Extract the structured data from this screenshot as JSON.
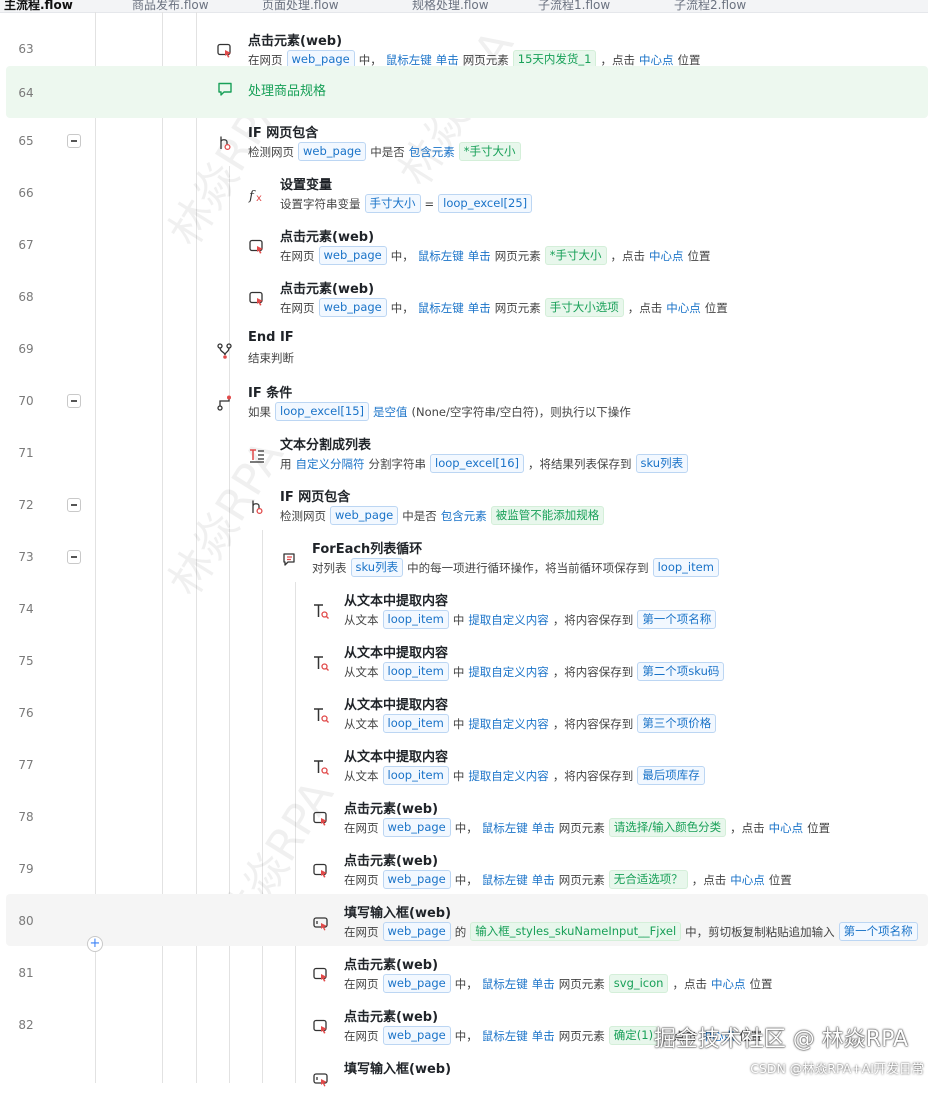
{
  "tabs": [
    "主流程.flow",
    "商品发布.flow",
    "页面处理.flow",
    "规格处理.flow",
    "子流程1.flow",
    "子流程2.flow"
  ],
  "watermark": "林焱RPA",
  "add_button": "+",
  "footer": {
    "brand": "掘金技术社区 @ 林焱RPA",
    "credit": "CSDN @林焱RPA+AI开发日常"
  },
  "icons": {
    "click": "mouse-click-icon",
    "comment": "comment-icon",
    "if_page": "branch-if-icon",
    "variable": "fx-variable-icon",
    "end_if": "end-branch-icon",
    "if_cond": "condition-icon",
    "split": "text-split-icon",
    "foreach": "loop-icon",
    "extract": "text-extract-icon",
    "fill": "input-fill-icon"
  },
  "rows": [
    {
      "no": "63",
      "title": "点击元素(web)",
      "icon": "click",
      "desc": [
        [
          "t",
          "在网页"
        ],
        [
          "c",
          "web_page"
        ],
        [
          "t",
          "中，"
        ],
        [
          "k",
          "鼠标左键"
        ],
        [
          "k",
          "单击"
        ],
        [
          "t",
          "网页元素"
        ],
        [
          "g",
          "15天内发货_1"
        ],
        [
          "t",
          "，点击"
        ],
        [
          "k",
          "中心点"
        ],
        [
          "t",
          "位置"
        ]
      ]
    },
    {
      "no": "64",
      "title": "处理商品规格",
      "icon": "comment",
      "comment": true
    },
    {
      "no": "65",
      "title": "IF 网页包含",
      "icon": "if_page",
      "fold": true,
      "desc": [
        [
          "t",
          "检测网页"
        ],
        [
          "c",
          "web_page"
        ],
        [
          "t",
          "中是否"
        ],
        [
          "k",
          "包含元素"
        ],
        [
          "g",
          "*手寸大小"
        ]
      ]
    },
    {
      "no": "66",
      "title": "设置变量",
      "icon": "variable",
      "desc": [
        [
          "t",
          "设置字符串变量"
        ],
        [
          "c",
          "手寸大小"
        ],
        [
          "t",
          "="
        ],
        [
          "c",
          "loop_excel[25]"
        ]
      ]
    },
    {
      "no": "67",
      "title": "点击元素(web)",
      "icon": "click",
      "desc": [
        [
          "t",
          "在网页"
        ],
        [
          "c",
          "web_page"
        ],
        [
          "t",
          "中，"
        ],
        [
          "k",
          "鼠标左键"
        ],
        [
          "k",
          "单击"
        ],
        [
          "t",
          "网页元素"
        ],
        [
          "g",
          "*手寸大小"
        ],
        [
          "t",
          "，点击"
        ],
        [
          "k",
          "中心点"
        ],
        [
          "t",
          "位置"
        ]
      ]
    },
    {
      "no": "68",
      "title": "点击元素(web)",
      "icon": "click",
      "desc": [
        [
          "t",
          "在网页"
        ],
        [
          "c",
          "web_page"
        ],
        [
          "t",
          "中，"
        ],
        [
          "k",
          "鼠标左键"
        ],
        [
          "k",
          "单击"
        ],
        [
          "t",
          "网页元素"
        ],
        [
          "g",
          "手寸大小选项"
        ],
        [
          "t",
          "，点击"
        ],
        [
          "k",
          "中心点"
        ],
        [
          "t",
          "位置"
        ]
      ]
    },
    {
      "no": "69",
      "title": "End IF",
      "icon": "end_if",
      "desc": [
        [
          "t",
          "结束判断"
        ]
      ]
    },
    {
      "no": "70",
      "title": "IF 条件",
      "icon": "if_cond",
      "fold": true,
      "desc": [
        [
          "t",
          "如果"
        ],
        [
          "c",
          "loop_excel[15]"
        ],
        [
          "k",
          "是空值"
        ],
        [
          "t",
          "(None/空字符串/空白符)，则执行以下操作"
        ]
      ]
    },
    {
      "no": "71",
      "title": "文本分割成列表",
      "icon": "split",
      "desc": [
        [
          "t",
          "用"
        ],
        [
          "k",
          "自定义分隔符"
        ],
        [
          "t",
          "分割字符串"
        ],
        [
          "c",
          "loop_excel[16]"
        ],
        [
          "t",
          "，将结果列表保存到"
        ],
        [
          "c",
          "sku列表"
        ]
      ]
    },
    {
      "no": "72",
      "title": "IF 网页包含",
      "icon": "if_page",
      "fold": true,
      "desc": [
        [
          "t",
          "检测网页"
        ],
        [
          "c",
          "web_page"
        ],
        [
          "t",
          "中是否"
        ],
        [
          "k",
          "包含元素"
        ],
        [
          "g",
          "被监管不能添加规格"
        ]
      ]
    },
    {
      "no": "73",
      "title": "ForEach列表循环",
      "icon": "foreach",
      "fold": true,
      "desc": [
        [
          "t",
          "对列表"
        ],
        [
          "c",
          "sku列表"
        ],
        [
          "t",
          "中的每一项进行循环操作，将当前循环项保存到"
        ],
        [
          "c",
          "loop_item"
        ]
      ]
    },
    {
      "no": "74",
      "title": "从文本中提取内容",
      "icon": "extract",
      "desc": [
        [
          "t",
          "从文本"
        ],
        [
          "c",
          "loop_item"
        ],
        [
          "t",
          "中"
        ],
        [
          "k",
          "提取自定义内容"
        ],
        [
          "t",
          "，将内容保存到"
        ],
        [
          "c",
          "第一个项名称"
        ]
      ]
    },
    {
      "no": "75",
      "title": "从文本中提取内容",
      "icon": "extract",
      "desc": [
        [
          "t",
          "从文本"
        ],
        [
          "c",
          "loop_item"
        ],
        [
          "t",
          "中"
        ],
        [
          "k",
          "提取自定义内容"
        ],
        [
          "t",
          "，将内容保存到"
        ],
        [
          "c",
          "第二个项sku码"
        ]
      ]
    },
    {
      "no": "76",
      "title": "从文本中提取内容",
      "icon": "extract",
      "desc": [
        [
          "t",
          "从文本"
        ],
        [
          "c",
          "loop_item"
        ],
        [
          "t",
          "中"
        ],
        [
          "k",
          "提取自定义内容"
        ],
        [
          "t",
          "，将内容保存到"
        ],
        [
          "c",
          "第三个项价格"
        ]
      ]
    },
    {
      "no": "77",
      "title": "从文本中提取内容",
      "icon": "extract",
      "desc": [
        [
          "t",
          "从文本"
        ],
        [
          "c",
          "loop_item"
        ],
        [
          "t",
          "中"
        ],
        [
          "k",
          "提取自定义内容"
        ],
        [
          "t",
          "，将内容保存到"
        ],
        [
          "c",
          "最后项库存"
        ]
      ]
    },
    {
      "no": "78",
      "title": "点击元素(web)",
      "icon": "click",
      "desc": [
        [
          "t",
          "在网页"
        ],
        [
          "c",
          "web_page"
        ],
        [
          "t",
          "中，"
        ],
        [
          "k",
          "鼠标左键"
        ],
        [
          "k",
          "单击"
        ],
        [
          "t",
          "网页元素"
        ],
        [
          "g",
          "请选择/输入颜色分类"
        ],
        [
          "t",
          "，点击"
        ],
        [
          "k",
          "中心点"
        ],
        [
          "t",
          "位置"
        ]
      ]
    },
    {
      "no": "79",
      "title": "点击元素(web)",
      "icon": "click",
      "desc": [
        [
          "t",
          "在网页"
        ],
        [
          "c",
          "web_page"
        ],
        [
          "t",
          "中，"
        ],
        [
          "k",
          "鼠标左键"
        ],
        [
          "k",
          "单击"
        ],
        [
          "t",
          "网页元素"
        ],
        [
          "g",
          "无合适选项？"
        ],
        [
          "t",
          "，点击"
        ],
        [
          "k",
          "中心点"
        ],
        [
          "t",
          "位置"
        ]
      ]
    },
    {
      "no": "80",
      "title": "填写输入框(web)",
      "icon": "fill",
      "hover": true,
      "desc": [
        [
          "t",
          "在网页"
        ],
        [
          "c",
          "web_page"
        ],
        [
          "t",
          "的"
        ],
        [
          "g",
          "输入框_styles_skuNameInput__Fjxel"
        ],
        [
          "t",
          "中，剪切板复制粘贴追加输入"
        ],
        [
          "c",
          "第一个项名称"
        ]
      ]
    },
    {
      "no": "81",
      "title": "点击元素(web)",
      "icon": "click",
      "desc": [
        [
          "t",
          "在网页"
        ],
        [
          "c",
          "web_page"
        ],
        [
          "t",
          "中，"
        ],
        [
          "k",
          "鼠标左键"
        ],
        [
          "k",
          "单击"
        ],
        [
          "t",
          "网页元素"
        ],
        [
          "g",
          "svg_icon"
        ],
        [
          "t",
          "，点击"
        ],
        [
          "k",
          "中心点"
        ],
        [
          "t",
          "位置"
        ]
      ]
    },
    {
      "no": "82",
      "title": "点击元素(web)",
      "icon": "click",
      "desc": [
        [
          "t",
          "在网页"
        ],
        [
          "c",
          "web_page"
        ],
        [
          "t",
          "中，"
        ],
        [
          "k",
          "鼠标左键"
        ],
        [
          "k",
          "单击"
        ],
        [
          "t",
          "网页元素"
        ],
        [
          "g",
          "确定(1)"
        ],
        [
          "t",
          "，点击"
        ],
        [
          "k",
          "中心点"
        ],
        [
          "t",
          "位置"
        ]
      ]
    },
    {
      "no": "",
      "title": "填写输入框(web)",
      "icon": "fill",
      "desc": []
    }
  ]
}
